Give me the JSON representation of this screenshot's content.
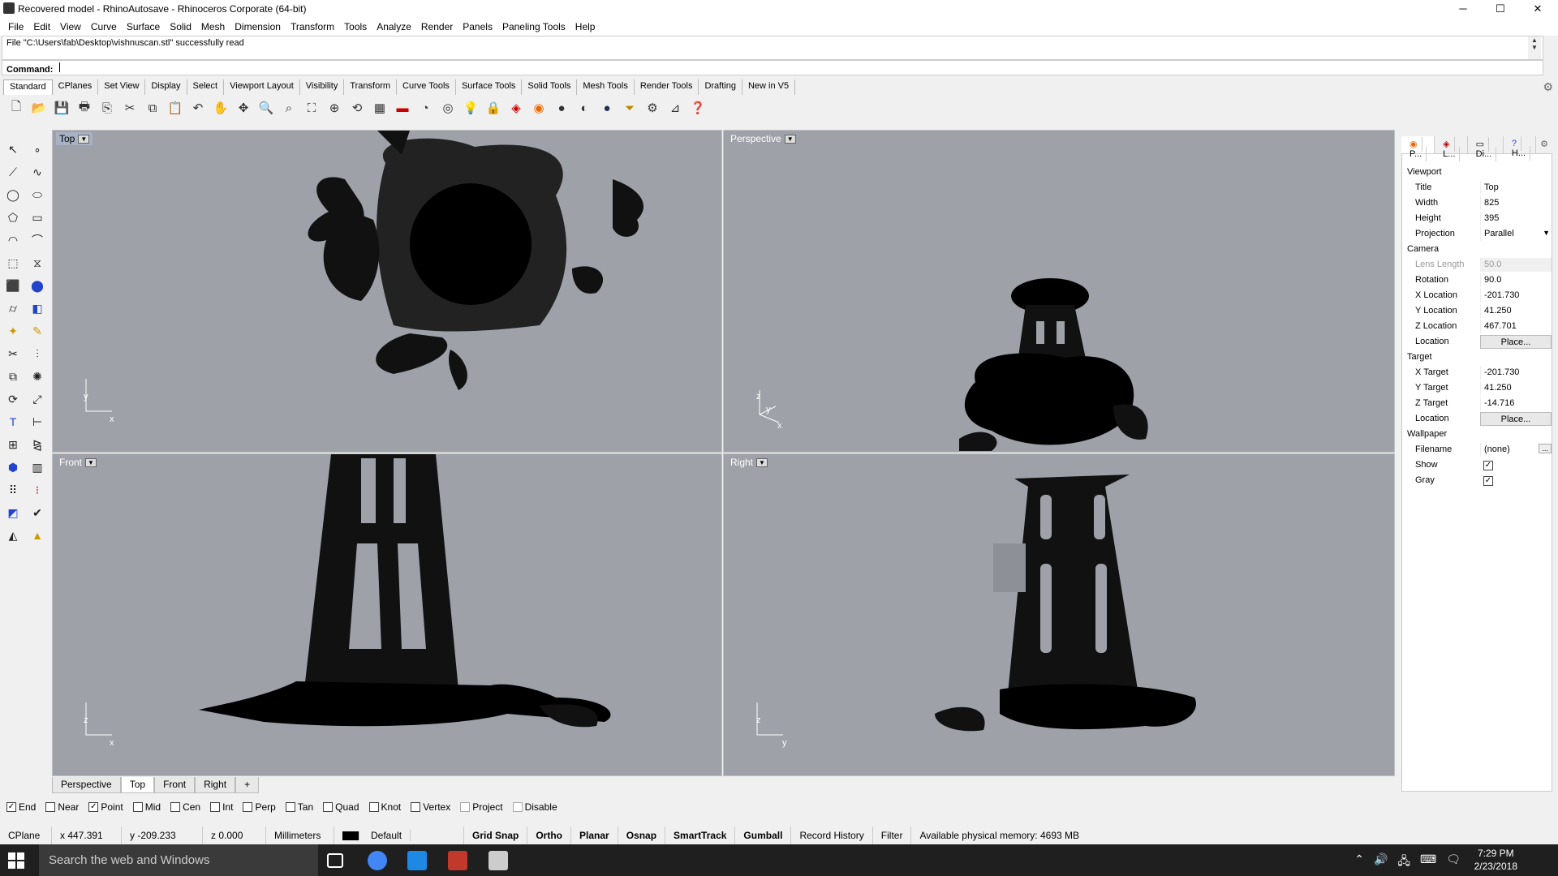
{
  "window": {
    "title": "Recovered model - RhinoAutosave - Rhinoceros Corporate (64-bit)",
    "min": "─",
    "max": "☐",
    "close": "✕"
  },
  "menu": [
    "File",
    "Edit",
    "View",
    "Curve",
    "Surface",
    "Solid",
    "Mesh",
    "Dimension",
    "Transform",
    "Tools",
    "Analyze",
    "Render",
    "Panels",
    "Paneling Tools",
    "Help"
  ],
  "command": {
    "history": "File \"C:\\Users\\fab\\Desktop\\vishnuscan.stl\" successfully read",
    "prompt": "Command:",
    "value": ""
  },
  "toolbar_tabs": [
    "Standard",
    "CPlanes",
    "Set View",
    "Display",
    "Select",
    "Viewport Layout",
    "Visibility",
    "Transform",
    "Curve Tools",
    "Surface Tools",
    "Solid Tools",
    "Mesh Tools",
    "Render Tools",
    "Drafting",
    "New in V5"
  ],
  "toolbar_icons": [
    "new-icon",
    "open-icon",
    "save-icon",
    "print-icon",
    "import-icon",
    "cut-icon",
    "copy-icon",
    "paste-icon",
    "undo-icon",
    "pan-icon",
    "move-icon",
    "zoom-icon",
    "zoom-window-icon",
    "zoom-extents-icon",
    "zoom-selected-icon",
    "rotate-view-icon",
    "grid-icon",
    "car-icon",
    "hide-icon",
    "show-icon",
    "light-icon",
    "lock-icon",
    "layer-icon",
    "color-icon",
    "shade-icon",
    "render-icon",
    "sphere-icon",
    "filter-icon",
    "settings-icon",
    "dimension-icon",
    "help-icon"
  ],
  "viewports": {
    "top": {
      "label": "Top",
      "axis1": "y",
      "axis2": "x"
    },
    "perspective": {
      "label": "Perspective",
      "axis1": "z",
      "axis2": "y",
      "axis3": "x"
    },
    "front": {
      "label": "Front",
      "axis1": "z",
      "axis2": "x"
    },
    "right": {
      "label": "Right",
      "axis1": "z",
      "axis2": "y"
    }
  },
  "viewport_tabs": [
    "Perspective",
    "Top",
    "Front",
    "Right",
    "+"
  ],
  "osnap": [
    {
      "label": "End",
      "checked": true
    },
    {
      "label": "Near",
      "checked": false
    },
    {
      "label": "Point",
      "checked": true
    },
    {
      "label": "Mid",
      "checked": false
    },
    {
      "label": "Cen",
      "checked": false
    },
    {
      "label": "Int",
      "checked": false
    },
    {
      "label": "Perp",
      "checked": false
    },
    {
      "label": "Tan",
      "checked": false
    },
    {
      "label": "Quad",
      "checked": false
    },
    {
      "label": "Knot",
      "checked": false
    },
    {
      "label": "Vertex",
      "checked": false
    },
    {
      "label": "Project",
      "checked": false
    },
    {
      "label": "Disable",
      "checked": false
    }
  ],
  "status": {
    "cplane": "CPlane",
    "x": "x 447.391",
    "y": "y -209.233",
    "z": "z 0.000",
    "units": "Millimeters",
    "layer": "Default",
    "grid_snap": "Grid Snap",
    "ortho": "Ortho",
    "planar": "Planar",
    "osnap": "Osnap",
    "smarttrack": "SmartTrack",
    "gumball": "Gumball",
    "record": "Record History",
    "filter": "Filter",
    "memory": "Available physical memory: 4693 MB"
  },
  "panel": {
    "tabs": [
      "P...",
      "L...",
      "Di...",
      "H..."
    ],
    "viewport_h": "Viewport",
    "title_k": "Title",
    "title_v": "Top",
    "width_k": "Width",
    "width_v": "825",
    "height_k": "Height",
    "height_v": "395",
    "proj_k": "Projection",
    "proj_v": "Parallel",
    "camera_h": "Camera",
    "lens_k": "Lens Length",
    "lens_v": "50.0",
    "rot_k": "Rotation",
    "rot_v": "90.0",
    "xloc_k": "X Location",
    "xloc_v": "-201.730",
    "yloc_k": "Y Location",
    "yloc_v": "41.250",
    "zloc_k": "Z Location",
    "zloc_v": "467.701",
    "loc_k": "Location",
    "loc_v": "Place...",
    "target_h": "Target",
    "xt_k": "X Target",
    "xt_v": "-201.730",
    "yt_k": "Y Target",
    "yt_v": "41.250",
    "zt_k": "Z Target",
    "zt_v": "-14.716",
    "tloc_k": "Location",
    "tloc_v": "Place...",
    "wall_h": "Wallpaper",
    "file_k": "Filename",
    "file_v": "(none)",
    "show_k": "Show",
    "gray_k": "Gray"
  },
  "taskbar": {
    "search": "Search the web and Windows",
    "time": "7:29 PM",
    "date": "2/23/2018"
  }
}
